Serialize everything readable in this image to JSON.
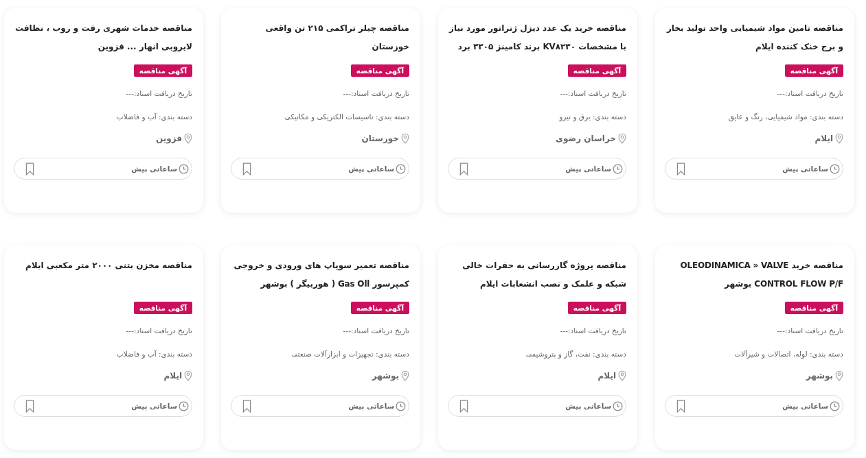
{
  "cards": [
    {
      "title": "مناقصه تامین مواد شیمیایی واحد تولید بخار و برج خنک کننده ایلام",
      "badge": "آگهی مناقصه",
      "doc_date": "تاریخ دریافت اسناد:---",
      "category": "دسته بندی: مواد شیمیایی، رنگ و عایق",
      "location": "ایلام",
      "time": "ساعاتی پیش"
    },
    {
      "title": "مناقصه خرید یک عدد دیزل ژنراتور مورد نیاز با مشخصات KV۸۲۳۰ برند کامینز ۳۳۰۵ برد",
      "badge": "آگهی مناقصه",
      "doc_date": "تاریخ دریافت اسناد:---",
      "category": "دسته بندی: برق و نیرو",
      "location": "خراسان رضوی",
      "time": "ساعاتی پیش"
    },
    {
      "title": "مناقصه چیلر تراکمی ۲۱۵ تن واقعی خوزستان",
      "badge": "آگهی مناقصه",
      "doc_date": "تاریخ دریافت اسناد:---",
      "category": "دسته بندی: تاسیسات الکتریکی و مکانیکی",
      "location": "خوزستان",
      "time": "ساعاتی پیش"
    },
    {
      "title": "مناقصه خدمات شهری رفت و روب ، نظافت لایروبی انهار ... قزوین",
      "badge": "آگهی مناقصه",
      "doc_date": "تاریخ دریافت اسناد:---",
      "category": "دسته بندی: آب و فاضلاب",
      "location": "قزوین",
      "time": "ساعاتی پیش"
    },
    {
      "title": "مناقصه خرید OLEODINAMICA » VALVE CONTROL FLOW P/F بوشهر",
      "badge": "آگهی مناقصه",
      "doc_date": "تاریخ دریافت اسناد:---",
      "category": "دسته بندی: لوله، اتصالات و شیرآلات",
      "location": "بوشهر",
      "time": "ساعاتی پیش"
    },
    {
      "title": "مناقصه پروژه گازرسانی به حفرات خالی شبکه و علمک و نصب انشعابات ایلام",
      "badge": "آگهی مناقصه",
      "doc_date": "تاریخ دریافت اسناد:---",
      "category": "دسته بندی: نفت، گاز و پتروشیمی",
      "location": "ایلام",
      "time": "ساعاتی پیش"
    },
    {
      "title": "مناقصه تعمیر سوپاپ های ورودی و خروجی کمپرسور Gas Oll ( هوربیگر ) بوشهر",
      "badge": "آگهی مناقصه",
      "doc_date": "تاریخ دریافت اسناد:---",
      "category": "دسته بندی: تجهیزات و ابزارآلات صنعتی",
      "location": "بوشهر",
      "time": "ساعاتی پیش"
    },
    {
      "title": "مناقصه مخزن بتنی ۲۰۰۰ متر مکعبی ایلام",
      "badge": "آگهی مناقصه",
      "doc_date": "تاریخ دریافت اسناد:---",
      "category": "دسته بندی: آب و فاضلاب",
      "location": "ایلام",
      "time": "ساعاتی پیش"
    }
  ]
}
